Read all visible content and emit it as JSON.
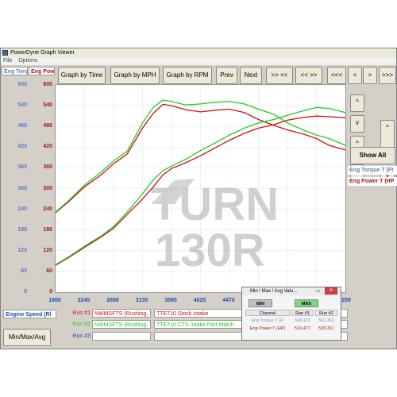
{
  "window": {
    "title": "PowerDyne Graph Viewer"
  },
  "menu": [
    "File",
    "Options"
  ],
  "axes_headers": {
    "torque": "Eng Torq",
    "power": "Eng Powe"
  },
  "colors": {
    "torque_axis": "#5b7cc8",
    "power_axis": "#a01818",
    "run1": "#d01010",
    "run2": "#22cc22",
    "run3": "#2244cc",
    "xaxis": "#1c50b4"
  },
  "toolbar": {
    "graph_time": "Graph by Time",
    "graph_mph": "Graph by MPH",
    "graph_rpm": "Graph by RPM",
    "prev": "Prev",
    "next": "Next",
    "fast_fwd": ">> <<",
    "fast_back": "<< >>",
    "first": "<<<",
    "back": "<",
    "fwd": ">",
    "last": ">>>"
  },
  "side": {
    "show_all": "Show All",
    "up": "^",
    "down": "v"
  },
  "legend": {
    "torque": "Eng Torque T (Ft",
    "power": "Eng Power T (HP"
  },
  "bottom": {
    "xaxis_channel": "Engine Speed (Rl",
    "runs": [
      {
        "label": "Run #1",
        "file": "NWMSFTS (Rushing,",
        "desc": "TTE710 Stock Intake"
      },
      {
        "label": "Run #2",
        "file": "NWMSFTS (Rushing,",
        "desc": "TTE710 CTS Intake Port Match"
      },
      {
        "label": "Run #3",
        "file": "",
        "desc": ""
      }
    ],
    "min_max_avg": "Min/Max/Avg"
  },
  "mma_panel": {
    "title": "Min / Max / Avg Valu...",
    "min_tab": "MIN",
    "max_tab": "MAX",
    "headers": [
      "Channel",
      "Run #1",
      "Run #2"
    ],
    "rows": [
      {
        "channel": "Eng Torque T (Ft",
        "run1": "549.113",
        "run2": "562.362"
      },
      {
        "channel": "Eng Power T (HP)",
        "run1": "519.477",
        "run2": "539.311"
      }
    ]
  },
  "watermark": {
    "line1": "TURN",
    "line2": "130R"
  },
  "chart_data": {
    "type": "line",
    "x_ticks": [
      "1800",
      "2245",
      "2690",
      "3135",
      "3580",
      "4025",
      "4470",
      "4915",
      "5360",
      "5805",
      "6250"
    ],
    "torque_ticks": [
      "600",
      "540",
      "480",
      "420",
      "360",
      "300",
      "240",
      "180",
      "120",
      "60",
      "0"
    ],
    "power_ticks": [
      "600",
      "540",
      "480",
      "420",
      "360",
      "300",
      "240",
      "180",
      "120",
      "60",
      "0"
    ],
    "xlim": [
      1800,
      6250
    ],
    "ylim": [
      0,
      600
    ],
    "series": [
      {
        "name": "Run #1 Eng Torque T",
        "color": "#d01010",
        "x": [
          1800,
          2000,
          2245,
          2500,
          2690,
          2900,
          3135,
          3300,
          3450,
          3580,
          3800,
          4025,
          4250,
          4470,
          4700,
          4915,
          5150,
          5360,
          5600,
          5805,
          6000,
          6250
        ],
        "y": [
          230,
          262,
          305,
          340,
          372,
          400,
          475,
          518,
          544,
          540,
          528,
          522,
          527,
          530,
          520,
          500,
          483,
          470,
          458,
          445,
          425,
          412
        ]
      },
      {
        "name": "Run #2 Eng Torque T",
        "color": "#22cc22",
        "x": [
          1800,
          2000,
          2245,
          2500,
          2690,
          2900,
          3135,
          3300,
          3450,
          3580,
          3800,
          4025,
          4250,
          4470,
          4700,
          4915,
          5150,
          5360,
          5600,
          5805,
          6000,
          6250
        ],
        "y": [
          232,
          265,
          310,
          348,
          380,
          408,
          490,
          535,
          556,
          552,
          542,
          545,
          550,
          552,
          545,
          530,
          515,
          490,
          470,
          455,
          445,
          425
        ]
      },
      {
        "name": "Run #1 Eng Power T",
        "color": "#d01010",
        "x": [
          1800,
          2000,
          2245,
          2500,
          2690,
          2900,
          3135,
          3300,
          3450,
          3580,
          3800,
          4025,
          4250,
          4470,
          4700,
          4915,
          5150,
          5360,
          5600,
          5805,
          6000,
          6250
        ],
        "y": [
          78,
          100,
          130,
          160,
          185,
          225,
          270,
          305,
          340,
          358,
          375,
          395,
          418,
          440,
          460,
          475,
          485,
          498,
          506,
          510,
          508,
          505
        ]
      },
      {
        "name": "Run #2 Eng Power T",
        "color": "#22cc22",
        "x": [
          1800,
          2000,
          2245,
          2500,
          2690,
          2900,
          3135,
          3300,
          3450,
          3580,
          3800,
          4025,
          4250,
          4470,
          4700,
          4915,
          5150,
          5360,
          5600,
          5805,
          6000,
          6250
        ],
        "y": [
          80,
          102,
          133,
          163,
          190,
          232,
          285,
          325,
          352,
          365,
          385,
          410,
          432,
          455,
          475,
          490,
          500,
          512,
          525,
          535,
          532,
          520
        ]
      }
    ]
  }
}
